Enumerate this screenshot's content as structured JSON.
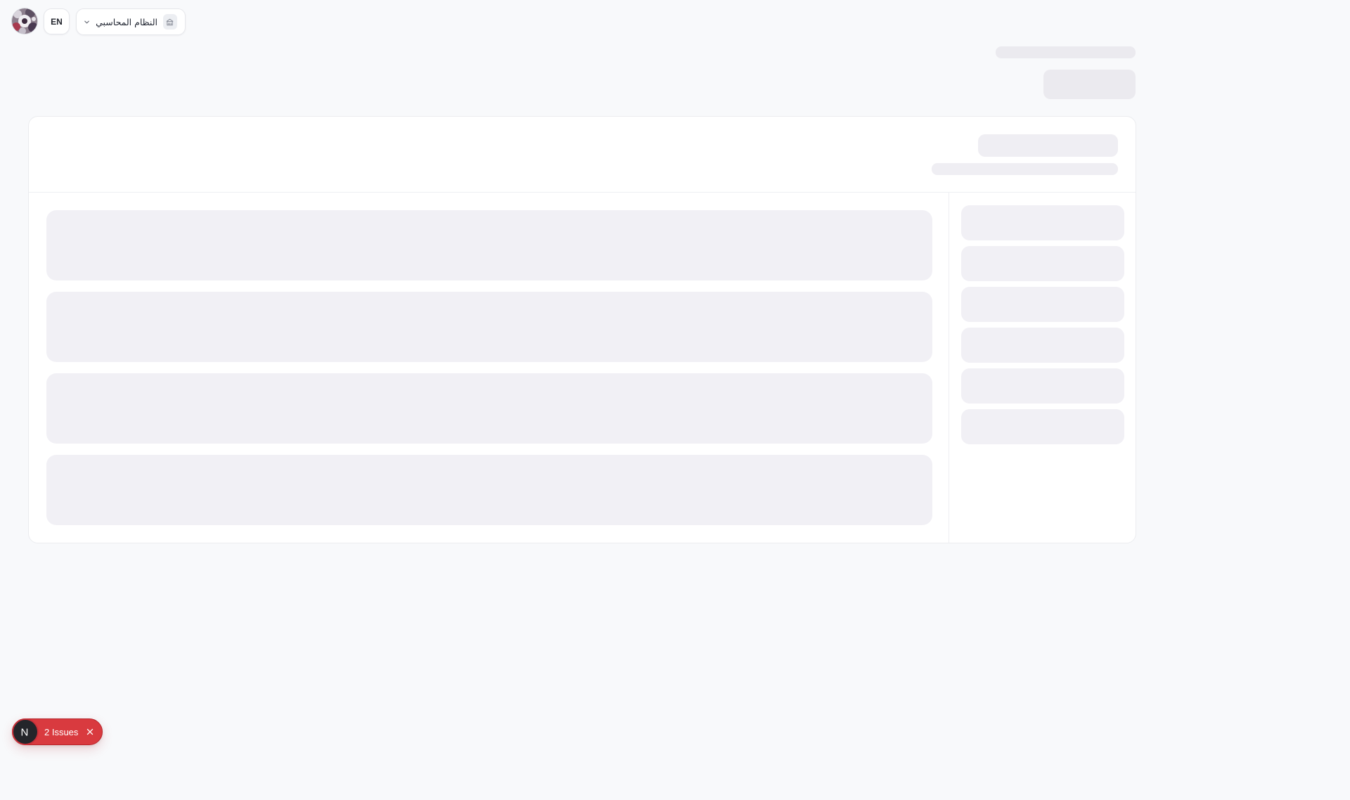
{
  "header": {
    "avatar_alt": "user-avatar",
    "language_button": "EN",
    "system_selector": {
      "label": "النظام المحاسبي",
      "icon": "building-icon",
      "chevron": "chevron-down-icon"
    }
  },
  "dev_overlay": {
    "logo_letter": "N",
    "issues_label": "2 Issues",
    "close_icon": "close-icon"
  },
  "colors": {
    "background": "#f8f9fb",
    "surface": "#ffffff",
    "skeleton": "#efeef3",
    "issues_bg": "#d93a3f"
  }
}
